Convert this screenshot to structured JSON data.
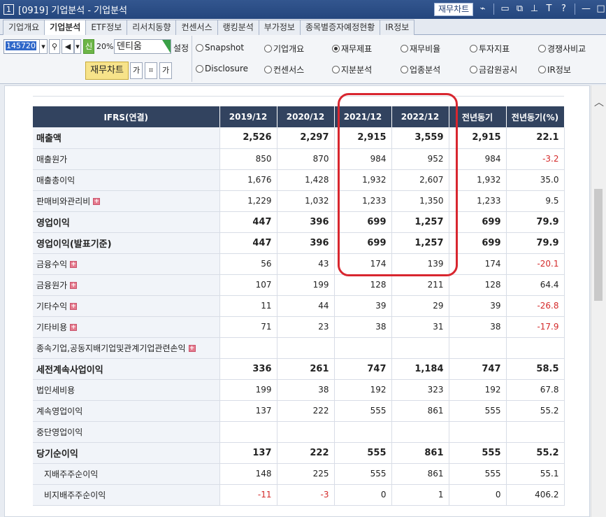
{
  "window": {
    "number": "1",
    "title": "[0919] 기업분석 - 기업분석",
    "fin_chart_button": "재무차트",
    "icons": [
      "chart-icon",
      "window-icon",
      "copy-icon",
      "pin-icon",
      "text-icon",
      "help-icon",
      "minimize-icon",
      "maximize-icon",
      "close-icon"
    ]
  },
  "tabs": [
    {
      "label": "기업개요",
      "active": false
    },
    {
      "label": "기업분석",
      "active": true
    },
    {
      "label": "ETF정보",
      "active": false
    },
    {
      "label": "리서치동향",
      "active": false
    },
    {
      "label": "컨센서스",
      "active": false
    },
    {
      "label": "랭킹분석",
      "active": false
    },
    {
      "label": "부가정보",
      "active": false
    },
    {
      "label": "종목별증자예정현황",
      "active": false
    },
    {
      "label": "IR정보",
      "active": false
    }
  ],
  "toolbar": {
    "stock_code": "145720",
    "new_label": "신",
    "percent": "20%",
    "stock_name": "덴티움",
    "setting": "설정",
    "fin_chart": "재무차트",
    "font_small": "가",
    "font_large": "가"
  },
  "radios": [
    {
      "label": "Snapshot",
      "checked": false
    },
    {
      "label": "기업개요",
      "checked": false
    },
    {
      "label": "재무제표",
      "checked": true
    },
    {
      "label": "재무비율",
      "checked": false
    },
    {
      "label": "투자지표",
      "checked": false
    },
    {
      "label": "경쟁사비교",
      "checked": false
    },
    {
      "label": "Disclosure",
      "checked": false
    },
    {
      "label": "컨센서스",
      "checked": false
    },
    {
      "label": "지분분석",
      "checked": false
    },
    {
      "label": "업종분석",
      "checked": false
    },
    {
      "label": "금감원공시",
      "checked": false
    },
    {
      "label": "IR정보",
      "checked": false
    }
  ],
  "table": {
    "headers": [
      "IFRS(연결)",
      "2019/12",
      "2020/12",
      "2021/12",
      "2022/12",
      "전년동기",
      "전년동기(%)"
    ],
    "rows": [
      {
        "label": "매출액",
        "bold": true,
        "expand": false,
        "sub": false,
        "values": [
          "2,526",
          "2,297",
          "2,915",
          "3,559",
          "2,915",
          "22.1"
        ],
        "neg": []
      },
      {
        "label": "매출원가",
        "bold": false,
        "expand": false,
        "sub": false,
        "values": [
          "850",
          "870",
          "984",
          "952",
          "984",
          "-3.2"
        ],
        "neg": [
          5
        ]
      },
      {
        "label": "매출총이익",
        "bold": false,
        "expand": false,
        "sub": false,
        "values": [
          "1,676",
          "1,428",
          "1,932",
          "2,607",
          "1,932",
          "35.0"
        ],
        "neg": []
      },
      {
        "label": "판매비와관리비",
        "bold": false,
        "expand": true,
        "sub": false,
        "values": [
          "1,229",
          "1,032",
          "1,233",
          "1,350",
          "1,233",
          "9.5"
        ],
        "neg": []
      },
      {
        "label": "영업이익",
        "bold": true,
        "expand": false,
        "sub": false,
        "values": [
          "447",
          "396",
          "699",
          "1,257",
          "699",
          "79.9"
        ],
        "neg": []
      },
      {
        "label": "영업이익(발표기준)",
        "bold": true,
        "expand": false,
        "sub": false,
        "values": [
          "447",
          "396",
          "699",
          "1,257",
          "699",
          "79.9"
        ],
        "neg": []
      },
      {
        "label": "금융수익",
        "bold": false,
        "expand": true,
        "sub": false,
        "values": [
          "56",
          "43",
          "174",
          "139",
          "174",
          "-20.1"
        ],
        "neg": [
          5
        ]
      },
      {
        "label": "금융원가",
        "bold": false,
        "expand": true,
        "sub": false,
        "values": [
          "107",
          "199",
          "128",
          "211",
          "128",
          "64.4"
        ],
        "neg": []
      },
      {
        "label": "기타수익",
        "bold": false,
        "expand": true,
        "sub": false,
        "values": [
          "11",
          "44",
          "39",
          "29",
          "39",
          "-26.8"
        ],
        "neg": [
          5
        ]
      },
      {
        "label": "기타비용",
        "bold": false,
        "expand": true,
        "sub": false,
        "values": [
          "71",
          "23",
          "38",
          "31",
          "38",
          "-17.9"
        ],
        "neg": [
          5
        ]
      },
      {
        "label": "종속기업,공동지배기업및관계기업관련손익",
        "bold": false,
        "expand": true,
        "sub": false,
        "values": [
          "",
          "",
          "",
          "",
          "",
          ""
        ],
        "neg": []
      },
      {
        "label": "세전계속사업이익",
        "bold": true,
        "expand": false,
        "sub": false,
        "values": [
          "336",
          "261",
          "747",
          "1,184",
          "747",
          "58.5"
        ],
        "neg": []
      },
      {
        "label": "법인세비용",
        "bold": false,
        "expand": false,
        "sub": false,
        "values": [
          "199",
          "38",
          "192",
          "323",
          "192",
          "67.8"
        ],
        "neg": []
      },
      {
        "label": "계속영업이익",
        "bold": false,
        "expand": false,
        "sub": false,
        "values": [
          "137",
          "222",
          "555",
          "861",
          "555",
          "55.2"
        ],
        "neg": []
      },
      {
        "label": "중단영업이익",
        "bold": false,
        "expand": false,
        "sub": false,
        "values": [
          "",
          "",
          "",
          "",
          "",
          ""
        ],
        "neg": []
      },
      {
        "label": "당기순이익",
        "bold": true,
        "expand": false,
        "sub": false,
        "values": [
          "137",
          "222",
          "555",
          "861",
          "555",
          "55.2"
        ],
        "neg": []
      },
      {
        "label": "지배주주순이익",
        "bold": false,
        "expand": false,
        "sub": true,
        "values": [
          "148",
          "225",
          "555",
          "861",
          "555",
          "55.1"
        ],
        "neg": []
      },
      {
        "label": "비지배주주순이익",
        "bold": false,
        "expand": false,
        "sub": true,
        "values": [
          "-11",
          "-3",
          "0",
          "1",
          "0",
          "406.2"
        ],
        "neg": [
          0,
          1
        ]
      }
    ]
  }
}
